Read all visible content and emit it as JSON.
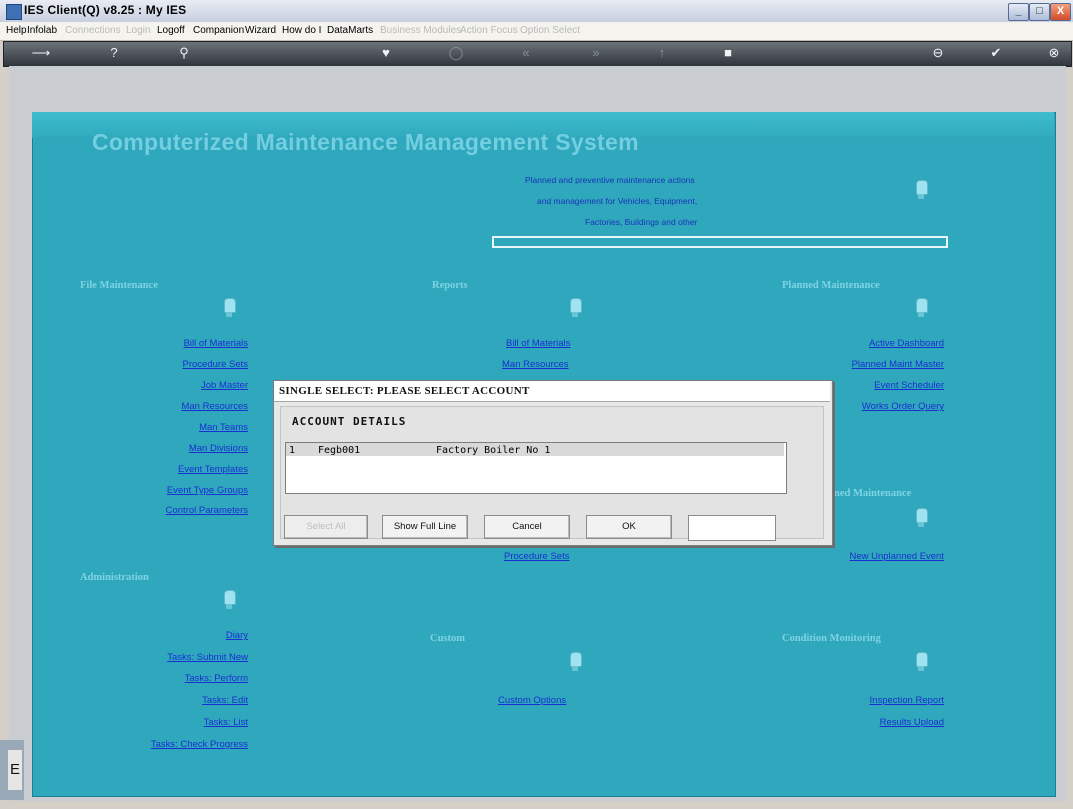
{
  "window": {
    "title": "IES Client(Q) v8.25 : My IES",
    "buttons": {
      "minimize": "_",
      "maximize": "□",
      "close": "X"
    }
  },
  "menu": [
    {
      "label": "Help",
      "disabled": false
    },
    {
      "label": "Infolab",
      "disabled": false
    },
    {
      "label": "Connections",
      "disabled": true
    },
    {
      "label": "Login",
      "disabled": true
    },
    {
      "label": "Logoff",
      "disabled": false
    },
    {
      "label": "Companion",
      "disabled": false
    },
    {
      "label": "Wizard",
      "disabled": false
    },
    {
      "label": "How do I",
      "disabled": false
    },
    {
      "label": "DataMarts",
      "disabled": false
    },
    {
      "label": "Business Modules",
      "disabled": true
    },
    {
      "label": "Action Focus",
      "disabled": true
    },
    {
      "label": "Option Select",
      "disabled": true
    }
  ],
  "toolbar": {
    "icons": [
      "arrow-icon",
      "help-icon",
      "search-icon",
      "heart-icon",
      "circle-icon",
      "rewind-icon",
      "forward-icon",
      "up-icon",
      "square-icon",
      "minus-icon",
      "check-icon",
      "close-icon"
    ],
    "glyphs": [
      "⟶",
      "?",
      "⚲",
      "♥",
      "◯",
      "«",
      "»",
      "↑",
      "■",
      "⊖",
      "✔",
      "⊗"
    ]
  },
  "main": {
    "title": "Computerized Maintenance Management System",
    "description": [
      "Planned and preventive maintenance actions",
      "and management for Vehicles, Equipment,",
      "Factories, Buildings and other"
    ]
  },
  "sections": {
    "file_maintenance": {
      "title": "File Maintenance",
      "links": [
        "Bill of Materials",
        "Procedure Sets",
        "Job Master",
        "Man Resources",
        "Man Teams",
        "Man Divisions",
        "Event Templates",
        "Event Type Groups",
        "Control Parameters"
      ]
    },
    "reports": {
      "title": "Reports",
      "links": [
        "Bill of Materials",
        "Man Resources",
        "Procedure Sets"
      ]
    },
    "planned_maintenance": {
      "title": "Planned Maintenance",
      "links": [
        "Active Dashboard",
        "Planned Maint Master",
        "Event Scheduler",
        "Works Order Query"
      ]
    },
    "unplanned_maintenance": {
      "title": "ned Maintenance",
      "links": [
        "New Unplanned Event"
      ]
    },
    "administration": {
      "title": "Administration",
      "links": [
        "Diary",
        "Tasks: Submit New",
        "Tasks: Perform",
        "Tasks: Edit",
        "Tasks: List",
        "Tasks: Check Progress"
      ]
    },
    "custom": {
      "title": "Custom",
      "links": [
        "Custom Options"
      ]
    },
    "condition_monitoring": {
      "title": "Condition Monitoring",
      "links": [
        "Inspection Report",
        "Results Upload"
      ]
    }
  },
  "dialog": {
    "title": "SINGLE SELECT: PLEASE SELECT ACCOUNT",
    "heading": "ACCOUNT DETAILS",
    "rows": [
      {
        "index": "1",
        "code": "Fegb001",
        "name": "Factory Boiler No 1"
      }
    ],
    "buttons": {
      "select_all": "Select All",
      "show_full_line": "Show Full Line",
      "cancel": "Cancel",
      "ok": "OK"
    },
    "input_value": ""
  },
  "taskbar": {
    "label": "E"
  }
}
